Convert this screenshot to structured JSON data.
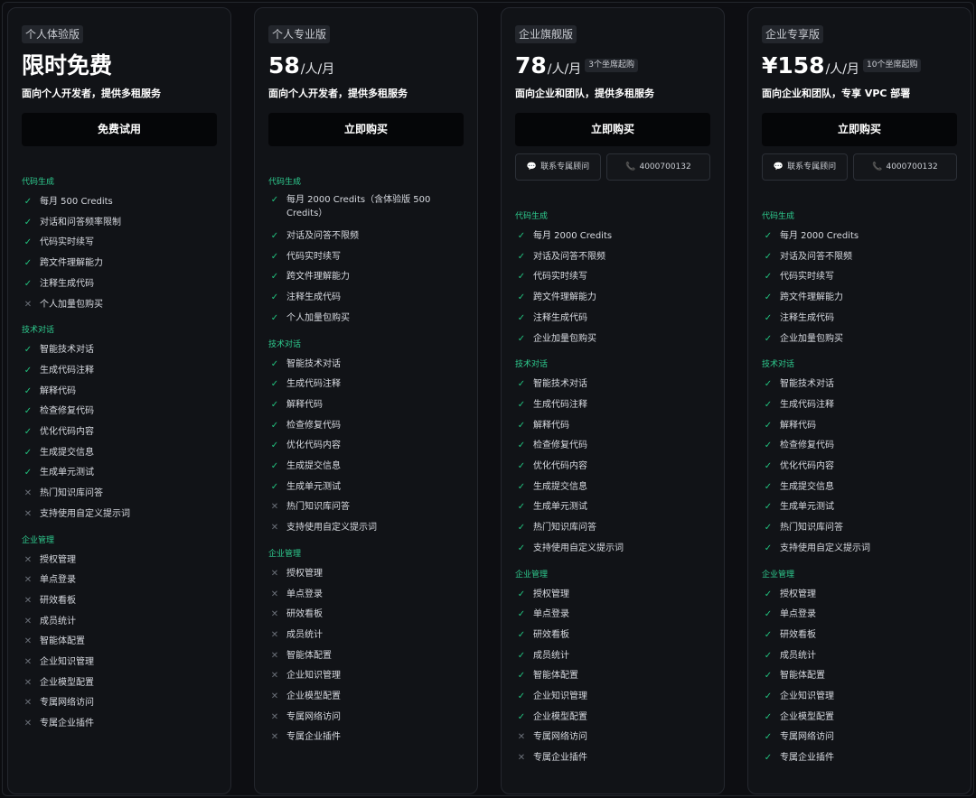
{
  "plans": [
    {
      "tag": "个人体验版",
      "price": "限时免费",
      "unit": "",
      "seat": "",
      "desc": "面向个人开发者，提供多租服务",
      "cta": "免费试用",
      "contact": null,
      "sections": [
        {
          "title": "代码生成",
          "items": [
            {
              "ok": true,
              "text": "每月 500 Credits"
            },
            {
              "ok": true,
              "text": "对话和问答频率限制"
            },
            {
              "ok": true,
              "text": "代码实时续写"
            },
            {
              "ok": true,
              "text": "跨文件理解能力"
            },
            {
              "ok": true,
              "text": "注释生成代码"
            },
            {
              "ok": false,
              "text": "个人加量包购买"
            }
          ]
        },
        {
          "title": "技术对话",
          "items": [
            {
              "ok": true,
              "text": "智能技术对话"
            },
            {
              "ok": true,
              "text": "生成代码注释"
            },
            {
              "ok": true,
              "text": "解释代码"
            },
            {
              "ok": true,
              "text": "检查修复代码"
            },
            {
              "ok": true,
              "text": "优化代码内容"
            },
            {
              "ok": true,
              "text": "生成提交信息"
            },
            {
              "ok": true,
              "text": "生成单元测试"
            },
            {
              "ok": false,
              "text": "热门知识库问答"
            },
            {
              "ok": false,
              "text": "支持使用自定义提示词"
            }
          ]
        },
        {
          "title": "企业管理",
          "items": [
            {
              "ok": false,
              "text": "授权管理"
            },
            {
              "ok": false,
              "text": "单点登录"
            },
            {
              "ok": false,
              "text": "研效看板"
            },
            {
              "ok": false,
              "text": "成员统计"
            },
            {
              "ok": false,
              "text": "智能体配置"
            },
            {
              "ok": false,
              "text": "企业知识管理"
            },
            {
              "ok": false,
              "text": "企业模型配置"
            },
            {
              "ok": false,
              "text": "专属网络访问"
            },
            {
              "ok": false,
              "text": "专属企业插件"
            }
          ]
        }
      ]
    },
    {
      "tag": "个人专业版",
      "price": "58",
      "unit": "/人/月",
      "seat": "",
      "desc": "面向个人开发者，提供多租服务",
      "cta": "立即购买",
      "contact": null,
      "sections": [
        {
          "title": "代码生成",
          "items": [
            {
              "ok": true,
              "text": "每月 2000 Credits（含体验版 500 Credits）",
              "wrap": true
            },
            {
              "ok": true,
              "text": "对话及问答不限频"
            },
            {
              "ok": true,
              "text": "代码实时续写"
            },
            {
              "ok": true,
              "text": "跨文件理解能力"
            },
            {
              "ok": true,
              "text": "注释生成代码"
            },
            {
              "ok": true,
              "text": "个人加量包购买"
            }
          ]
        },
        {
          "title": "技术对话",
          "items": [
            {
              "ok": true,
              "text": "智能技术对话"
            },
            {
              "ok": true,
              "text": "生成代码注释"
            },
            {
              "ok": true,
              "text": "解释代码"
            },
            {
              "ok": true,
              "text": "检查修复代码"
            },
            {
              "ok": true,
              "text": "优化代码内容"
            },
            {
              "ok": true,
              "text": "生成提交信息"
            },
            {
              "ok": true,
              "text": "生成单元测试"
            },
            {
              "ok": false,
              "text": "热门知识库问答"
            },
            {
              "ok": false,
              "text": "支持使用自定义提示词"
            }
          ]
        },
        {
          "title": "企业管理",
          "items": [
            {
              "ok": false,
              "text": "授权管理"
            },
            {
              "ok": false,
              "text": "单点登录"
            },
            {
              "ok": false,
              "text": "研效看板"
            },
            {
              "ok": false,
              "text": "成员统计"
            },
            {
              "ok": false,
              "text": "智能体配置"
            },
            {
              "ok": false,
              "text": "企业知识管理"
            },
            {
              "ok": false,
              "text": "企业模型配置"
            },
            {
              "ok": false,
              "text": "专属网络访问"
            },
            {
              "ok": false,
              "text": "专属企业插件"
            }
          ]
        }
      ]
    },
    {
      "tag": "企业旗舰版",
      "price": "78",
      "unit": "/人/月",
      "seat": "3个坐席起购",
      "desc": "面向企业和团队，提供多租服务",
      "cta": "立即购买",
      "contact": {
        "consult": "联系专属顾问",
        "phone": "4000700132"
      },
      "sections": [
        {
          "title": "代码生成",
          "items": [
            {
              "ok": true,
              "text": "每月 2000 Credits"
            },
            {
              "ok": true,
              "text": "对话及问答不限频"
            },
            {
              "ok": true,
              "text": "代码实时续写"
            },
            {
              "ok": true,
              "text": "跨文件理解能力"
            },
            {
              "ok": true,
              "text": "注释生成代码"
            },
            {
              "ok": true,
              "text": "企业加量包购买"
            }
          ]
        },
        {
          "title": "技术对话",
          "items": [
            {
              "ok": true,
              "text": "智能技术对话"
            },
            {
              "ok": true,
              "text": "生成代码注释"
            },
            {
              "ok": true,
              "text": "解释代码"
            },
            {
              "ok": true,
              "text": "检查修复代码"
            },
            {
              "ok": true,
              "text": "优化代码内容"
            },
            {
              "ok": true,
              "text": "生成提交信息"
            },
            {
              "ok": true,
              "text": "生成单元测试"
            },
            {
              "ok": true,
              "text": "热门知识库问答"
            },
            {
              "ok": true,
              "text": "支持使用自定义提示词"
            }
          ]
        },
        {
          "title": "企业管理",
          "items": [
            {
              "ok": true,
              "text": "授权管理"
            },
            {
              "ok": true,
              "text": "单点登录"
            },
            {
              "ok": true,
              "text": "研效看板"
            },
            {
              "ok": true,
              "text": "成员统计"
            },
            {
              "ok": true,
              "text": "智能体配置"
            },
            {
              "ok": true,
              "text": "企业知识管理"
            },
            {
              "ok": true,
              "text": "企业模型配置"
            },
            {
              "ok": false,
              "text": "专属网络访问"
            },
            {
              "ok": false,
              "text": "专属企业插件"
            }
          ]
        }
      ]
    },
    {
      "tag": "企业专享版",
      "price": "¥158",
      "unit": "/人/月",
      "seat": "10个坐席起购",
      "desc": "面向企业和团队，专享 VPC 部署",
      "cta": "立即购买",
      "contact": {
        "consult": "联系专属顾问",
        "phone": "4000700132"
      },
      "sections": [
        {
          "title": "代码生成",
          "items": [
            {
              "ok": true,
              "text": "每月 2000 Credits"
            },
            {
              "ok": true,
              "text": "对话及问答不限频"
            },
            {
              "ok": true,
              "text": "代码实时续写"
            },
            {
              "ok": true,
              "text": "跨文件理解能力"
            },
            {
              "ok": true,
              "text": "注释生成代码"
            },
            {
              "ok": true,
              "text": "企业加量包购买"
            }
          ]
        },
        {
          "title": "技术对话",
          "items": [
            {
              "ok": true,
              "text": "智能技术对话"
            },
            {
              "ok": true,
              "text": "生成代码注释"
            },
            {
              "ok": true,
              "text": "解释代码"
            },
            {
              "ok": true,
              "text": "检查修复代码"
            },
            {
              "ok": true,
              "text": "优化代码内容"
            },
            {
              "ok": true,
              "text": "生成提交信息"
            },
            {
              "ok": true,
              "text": "生成单元测试"
            },
            {
              "ok": true,
              "text": "热门知识库问答"
            },
            {
              "ok": true,
              "text": "支持使用自定义提示词"
            }
          ]
        },
        {
          "title": "企业管理",
          "items": [
            {
              "ok": true,
              "text": "授权管理"
            },
            {
              "ok": true,
              "text": "单点登录"
            },
            {
              "ok": true,
              "text": "研效看板"
            },
            {
              "ok": true,
              "text": "成员统计"
            },
            {
              "ok": true,
              "text": "智能体配置"
            },
            {
              "ok": true,
              "text": "企业知识管理"
            },
            {
              "ok": true,
              "text": "企业模型配置"
            },
            {
              "ok": true,
              "text": "专属网络访问"
            },
            {
              "ok": true,
              "text": "专属企业插件"
            }
          ]
        }
      ]
    }
  ],
  "icons": {
    "check": "check-icon",
    "cross": "cross-icon",
    "chat": "chat-bubble-icon",
    "phone": "phone-icon"
  },
  "colors": {
    "accent": "#22c17e",
    "section": "#2ecc8f",
    "muted": "#6b7079",
    "background": "#0d0e12",
    "card": "#111317"
  }
}
